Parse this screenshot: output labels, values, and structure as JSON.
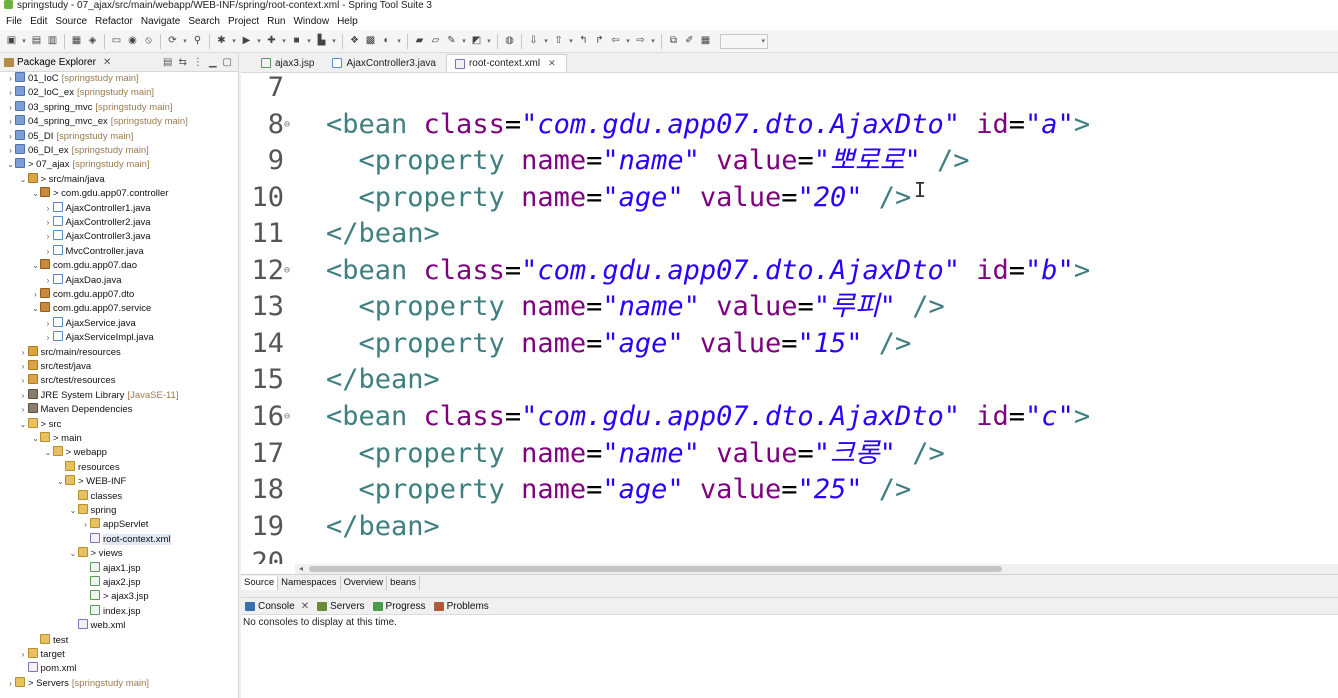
{
  "window": {
    "title": "springstudy - 07_ajax/src/main/webapp/WEB-INF/spring/root-context.xml - Spring Tool Suite 3"
  },
  "menu": [
    "File",
    "Edit",
    "Source",
    "Refactor",
    "Navigate",
    "Search",
    "Project",
    "Run",
    "Window",
    "Help"
  ],
  "explorer": {
    "tab_label": "Package Explorer",
    "tree": [
      {
        "label": "01_IoC",
        "ann": "[springstudy main]",
        "icon": "project",
        "twisty": ">",
        "indent": 0
      },
      {
        "label": "02_IoC_ex",
        "ann": "[springstudy main]",
        "icon": "project",
        "twisty": ">",
        "indent": 0
      },
      {
        "label": "03_spring_mvc",
        "ann": "[springstudy main]",
        "icon": "project",
        "twisty": ">",
        "indent": 0
      },
      {
        "label": "04_spring_mvc_ex",
        "ann": "[springstudy main]",
        "icon": "project",
        "twisty": ">",
        "indent": 0
      },
      {
        "label": "05_DI",
        "ann": "[springstudy main]",
        "icon": "project",
        "twisty": ">",
        "indent": 0
      },
      {
        "label": "06_DI_ex",
        "ann": "[springstudy main]",
        "icon": "project",
        "twisty": ">",
        "indent": 0
      },
      {
        "label": "> 07_ajax",
        "ann": "[springstudy main]",
        "icon": "project",
        "twisty": "v",
        "indent": 0
      },
      {
        "label": "> src/main/java",
        "ann": "",
        "icon": "srcfolder",
        "twisty": "v",
        "indent": 1
      },
      {
        "label": "> com.gdu.app07.controller",
        "ann": "",
        "icon": "package",
        "twisty": "v",
        "indent": 2
      },
      {
        "label": "AjaxController1.java",
        "ann": "",
        "icon": "java",
        "twisty": ">",
        "indent": 3
      },
      {
        "label": "AjaxController2.java",
        "ann": "",
        "icon": "java",
        "twisty": ">",
        "indent": 3
      },
      {
        "label": "AjaxController3.java",
        "ann": "",
        "icon": "java",
        "twisty": ">",
        "indent": 3
      },
      {
        "label": "MvcController.java",
        "ann": "",
        "icon": "java",
        "twisty": ">",
        "indent": 3
      },
      {
        "label": "com.gdu.app07.dao",
        "ann": "",
        "icon": "package",
        "twisty": "v",
        "indent": 2
      },
      {
        "label": "AjaxDao.java",
        "ann": "",
        "icon": "java",
        "twisty": ">",
        "indent": 3
      },
      {
        "label": "com.gdu.app07.dto",
        "ann": "",
        "icon": "package",
        "twisty": ">",
        "indent": 2
      },
      {
        "label": "com.gdu.app07.service",
        "ann": "",
        "icon": "package",
        "twisty": "v",
        "indent": 2
      },
      {
        "label": "AjaxService.java",
        "ann": "",
        "icon": "java",
        "twisty": ">",
        "indent": 3
      },
      {
        "label": "AjaxServiceImpl.java",
        "ann": "",
        "icon": "java",
        "twisty": ">",
        "indent": 3
      },
      {
        "label": "src/main/resources",
        "ann": "",
        "icon": "srcfolder",
        "twisty": ">",
        "indent": 1
      },
      {
        "label": "src/test/java",
        "ann": "",
        "icon": "srcfolder",
        "twisty": ">",
        "indent": 1
      },
      {
        "label": "src/test/resources",
        "ann": "",
        "icon": "srcfolder",
        "twisty": ">",
        "indent": 1
      },
      {
        "label": "JRE System Library",
        "ann": "[JavaSE-11]",
        "icon": "lib",
        "twisty": ">",
        "indent": 1
      },
      {
        "label": "Maven Dependencies",
        "ann": "",
        "icon": "lib",
        "twisty": ">",
        "indent": 1
      },
      {
        "label": "> src",
        "ann": "",
        "icon": "folder",
        "twisty": "v",
        "indent": 1
      },
      {
        "label": "> main",
        "ann": "",
        "icon": "folder",
        "twisty": "v",
        "indent": 2
      },
      {
        "label": "> webapp",
        "ann": "",
        "icon": "folder",
        "twisty": "v",
        "indent": 3
      },
      {
        "label": "resources",
        "ann": "",
        "icon": "folder",
        "twisty": "",
        "indent": 4
      },
      {
        "label": "> WEB-INF",
        "ann": "",
        "icon": "folder",
        "twisty": "v",
        "indent": 4
      },
      {
        "label": "classes",
        "ann": "",
        "icon": "folder",
        "twisty": "",
        "indent": 5
      },
      {
        "label": "spring",
        "ann": "",
        "icon": "folder",
        "twisty": "v",
        "indent": 5
      },
      {
        "label": "appServlet",
        "ann": "",
        "icon": "folder",
        "twisty": ">",
        "indent": 6
      },
      {
        "label": "root-context.xml",
        "ann": "",
        "icon": "xml",
        "twisty": "",
        "indent": 6,
        "selected": true
      },
      {
        "label": "> views",
        "ann": "",
        "icon": "folder",
        "twisty": "v",
        "indent": 5
      },
      {
        "label": "ajax1.jsp",
        "ann": "",
        "icon": "jsp",
        "twisty": "",
        "indent": 6
      },
      {
        "label": "ajax2.jsp",
        "ann": "",
        "icon": "jsp",
        "twisty": "",
        "indent": 6
      },
      {
        "label": "> ajax3.jsp",
        "ann": "",
        "icon": "jsp",
        "twisty": "",
        "indent": 6
      },
      {
        "label": "index.jsp",
        "ann": "",
        "icon": "jsp",
        "twisty": "",
        "indent": 6
      },
      {
        "label": "web.xml",
        "ann": "",
        "icon": "xml",
        "twisty": "",
        "indent": 5
      },
      {
        "label": "test",
        "ann": "",
        "icon": "folder",
        "twisty": "",
        "indent": 2
      },
      {
        "label": "target",
        "ann": "",
        "icon": "folder",
        "twisty": ">",
        "indent": 1
      },
      {
        "label": "pom.xml",
        "ann": "",
        "icon": "xml",
        "twisty": "",
        "indent": 1
      },
      {
        "label": "> Servers",
        "ann": "[springstudy main]",
        "icon": "folder",
        "twisty": ">",
        "indent": 0
      }
    ]
  },
  "editor": {
    "tabs": [
      {
        "label": "ajax3.jsp",
        "active": false
      },
      {
        "label": "AjaxController3.java",
        "active": false
      },
      {
        "label": "root-context.xml",
        "active": true
      }
    ],
    "lines": [
      {
        "num": "7",
        "fold": false,
        "tokens": []
      },
      {
        "num": "8",
        "fold": true,
        "tokens": [
          [
            "tag",
            "<bean "
          ],
          [
            "attr",
            "class"
          ],
          [
            "eq",
            "="
          ],
          [
            "val",
            "\"com.gdu.app07.dto.AjaxDto\""
          ],
          [
            "eq",
            " "
          ],
          [
            "attr",
            "id"
          ],
          [
            "eq",
            "="
          ],
          [
            "val",
            "\"a\""
          ],
          [
            "tag",
            ">"
          ]
        ]
      },
      {
        "num": "9",
        "fold": false,
        "tokens": [
          [
            "eq",
            "  "
          ],
          [
            "tag",
            "<property "
          ],
          [
            "attr",
            "name"
          ],
          [
            "eq",
            "="
          ],
          [
            "val",
            "\"name\""
          ],
          [
            "eq",
            " "
          ],
          [
            "attr",
            "value"
          ],
          [
            "eq",
            "="
          ],
          [
            "val",
            "\"뽀로로\""
          ],
          [
            "eq",
            " "
          ],
          [
            "tag",
            "/>"
          ]
        ]
      },
      {
        "num": "10",
        "fold": false,
        "tokens": [
          [
            "eq",
            "  "
          ],
          [
            "tag",
            "<property "
          ],
          [
            "attr",
            "name"
          ],
          [
            "eq",
            "="
          ],
          [
            "val",
            "\"age\""
          ],
          [
            "eq",
            " "
          ],
          [
            "attr",
            "value"
          ],
          [
            "eq",
            "="
          ],
          [
            "val",
            "\"20\""
          ],
          [
            "eq",
            " "
          ],
          [
            "tag",
            "/>"
          ]
        ]
      },
      {
        "num": "11",
        "fold": false,
        "tokens": [
          [
            "tag",
            "</bean>"
          ]
        ]
      },
      {
        "num": "12",
        "fold": true,
        "tokens": [
          [
            "tag",
            "<bean "
          ],
          [
            "attr",
            "class"
          ],
          [
            "eq",
            "="
          ],
          [
            "val",
            "\"com.gdu.app07.dto.AjaxDto\""
          ],
          [
            "eq",
            " "
          ],
          [
            "attr",
            "id"
          ],
          [
            "eq",
            "="
          ],
          [
            "val",
            "\"b\""
          ],
          [
            "tag",
            ">"
          ]
        ]
      },
      {
        "num": "13",
        "fold": false,
        "tokens": [
          [
            "eq",
            "  "
          ],
          [
            "tag",
            "<property "
          ],
          [
            "attr",
            "name"
          ],
          [
            "eq",
            "="
          ],
          [
            "val",
            "\"name\""
          ],
          [
            "eq",
            " "
          ],
          [
            "attr",
            "value"
          ],
          [
            "eq",
            "="
          ],
          [
            "val",
            "\"루피\""
          ],
          [
            "eq",
            " "
          ],
          [
            "tag",
            "/>"
          ]
        ]
      },
      {
        "num": "14",
        "fold": false,
        "tokens": [
          [
            "eq",
            "  "
          ],
          [
            "tag",
            "<property "
          ],
          [
            "attr",
            "name"
          ],
          [
            "eq",
            "="
          ],
          [
            "val",
            "\"age\""
          ],
          [
            "eq",
            " "
          ],
          [
            "attr",
            "value"
          ],
          [
            "eq",
            "="
          ],
          [
            "val",
            "\"15\""
          ],
          [
            "eq",
            " "
          ],
          [
            "tag",
            "/>"
          ]
        ]
      },
      {
        "num": "15",
        "fold": false,
        "tokens": [
          [
            "tag",
            "</bean>"
          ]
        ]
      },
      {
        "num": "16",
        "fold": true,
        "tokens": [
          [
            "tag",
            "<bean "
          ],
          [
            "attr",
            "class"
          ],
          [
            "eq",
            "="
          ],
          [
            "val",
            "\"com.gdu.app07.dto.AjaxDto\""
          ],
          [
            "eq",
            " "
          ],
          [
            "attr",
            "id"
          ],
          [
            "eq",
            "="
          ],
          [
            "val",
            "\"c\""
          ],
          [
            "tag",
            ">"
          ]
        ]
      },
      {
        "num": "17",
        "fold": false,
        "tokens": [
          [
            "eq",
            "  "
          ],
          [
            "tag",
            "<property "
          ],
          [
            "attr",
            "name"
          ],
          [
            "eq",
            "="
          ],
          [
            "val",
            "\"name\""
          ],
          [
            "eq",
            " "
          ],
          [
            "attr",
            "value"
          ],
          [
            "eq",
            "="
          ],
          [
            "val",
            "\"크롱\""
          ],
          [
            "eq",
            " "
          ],
          [
            "tag",
            "/>"
          ]
        ]
      },
      {
        "num": "18",
        "fold": false,
        "tokens": [
          [
            "eq",
            "  "
          ],
          [
            "tag",
            "<property "
          ],
          [
            "attr",
            "name"
          ],
          [
            "eq",
            "="
          ],
          [
            "val",
            "\"age\""
          ],
          [
            "eq",
            " "
          ],
          [
            "attr",
            "value"
          ],
          [
            "eq",
            "="
          ],
          [
            "val",
            "\"25\""
          ],
          [
            "eq",
            " "
          ],
          [
            "tag",
            "/>"
          ]
        ]
      },
      {
        "num": "19",
        "fold": false,
        "tokens": [
          [
            "tag",
            "</bean>"
          ]
        ]
      }
    ],
    "bottom_tabs": [
      "Source",
      "Namespaces",
      "Overview",
      "beans"
    ]
  },
  "console": {
    "tabs": [
      {
        "label": "Console",
        "closable": true
      },
      {
        "label": "Servers",
        "closable": false
      },
      {
        "label": "Progress",
        "closable": false
      },
      {
        "label": "Problems",
        "closable": false
      }
    ],
    "message": "No consoles to display at this time."
  },
  "colors": {
    "tag": "#3f7f7f",
    "attr": "#7f007f",
    "value": "#2a00ff",
    "selection": "#e0e8f4"
  }
}
